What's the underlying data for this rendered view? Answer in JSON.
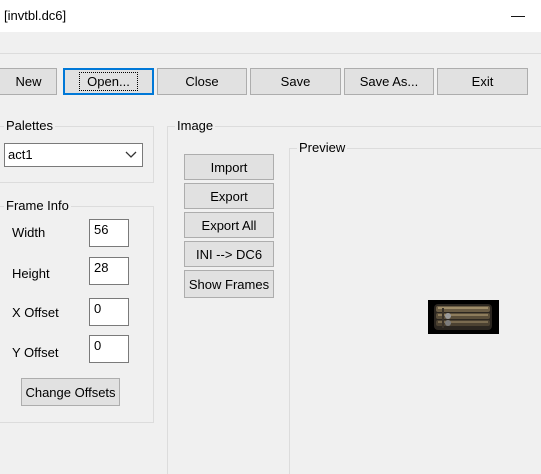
{
  "window": {
    "title": "[invtbl.dc6]",
    "minimize_glyph": "—"
  },
  "toolbar": {
    "new_label": "New",
    "open_label": "Open...",
    "close_label": "Close",
    "save_label": "Save",
    "save_as_label": "Save As...",
    "exit_label": "Exit"
  },
  "palettes": {
    "group_label": "Palettes",
    "selected": "act1"
  },
  "frame_info": {
    "group_label": "Frame Info",
    "width_label": "Width",
    "width_value": "56",
    "height_label": "Height",
    "height_value": "28",
    "x_offset_label": "X Offset",
    "x_offset_value": "0",
    "y_offset_label": "Y Offset",
    "y_offset_value": "0",
    "change_offsets_label": "Change Offsets"
  },
  "image": {
    "group_label": "Image",
    "import_label": "Import",
    "export_label": "Export",
    "export_all_label": "Export All",
    "ini_to_dc6_label": "INI --> DC6",
    "show_frames_label": "Show Frames"
  },
  "preview": {
    "group_label": "Preview"
  },
  "colors": {
    "window_bg": "#f0f0f0",
    "button_bg": "#e1e1e1",
    "focus_border": "#0078d7"
  }
}
